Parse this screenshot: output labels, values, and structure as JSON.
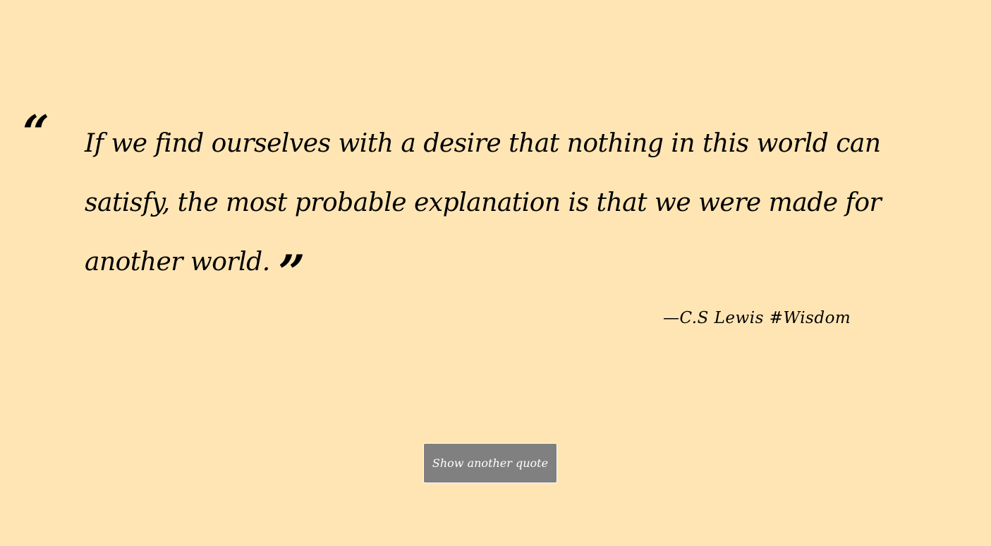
{
  "quote": {
    "open_mark": "“",
    "text": "If we find ourselves with a desire that nothing in this world can satisfy, the most probable explanation is that we were made for another world.",
    "close_mark": "”"
  },
  "attribution": {
    "text": "—C.S Lewis #Wisdom"
  },
  "button": {
    "label": "Show another quote"
  },
  "colors": {
    "background": "#FFE5B4",
    "text": "#000000",
    "button_bg": "#808080",
    "button_text": "#FFFFFF"
  }
}
